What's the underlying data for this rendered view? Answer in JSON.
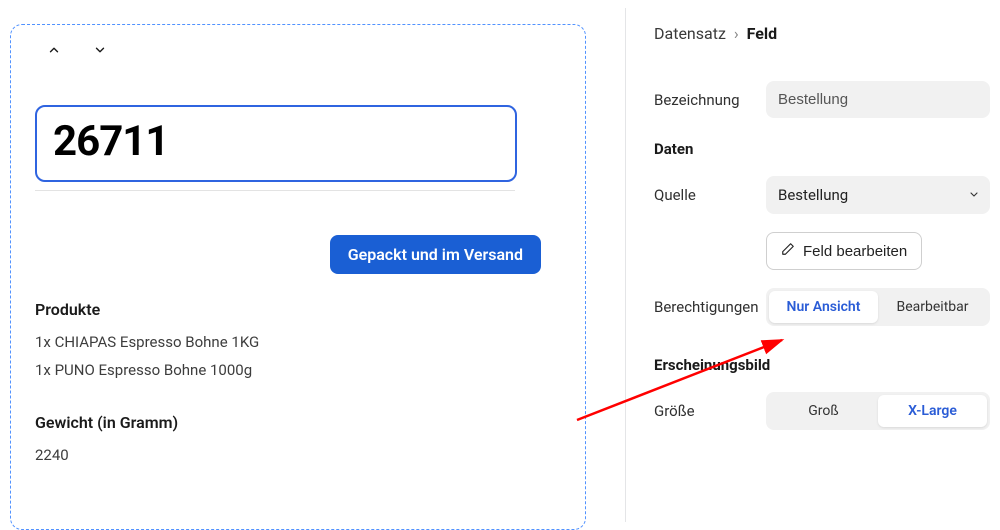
{
  "main": {
    "order_number": "26711",
    "status_badge": "Gepackt und im Versand",
    "products_label": "Produkte",
    "products": [
      "1x CHIAPAS Espresso Bohne 1KG",
      "1x PUNO Espresso Bohne 1000g"
    ],
    "weight_label": "Gewicht (in Gramm)",
    "weight_value": "2240"
  },
  "panel": {
    "breadcrumb": {
      "parent": "Datensatz",
      "current": "Feld"
    },
    "label_field": {
      "label": "Bezeichnung",
      "value": "Bestellung"
    },
    "data_section": "Daten",
    "source": {
      "label": "Quelle",
      "value": "Bestellung"
    },
    "edit_field_btn": "Feld bearbeiten",
    "permissions": {
      "label": "Berechtigun­gen",
      "option_view": "Nur Ansicht",
      "option_edit": "Bearbeitbar"
    },
    "appearance_section": "Erscheinungsbild",
    "size": {
      "label": "Größe",
      "option_large": "Groß",
      "option_xlarge": "X-Large"
    }
  }
}
